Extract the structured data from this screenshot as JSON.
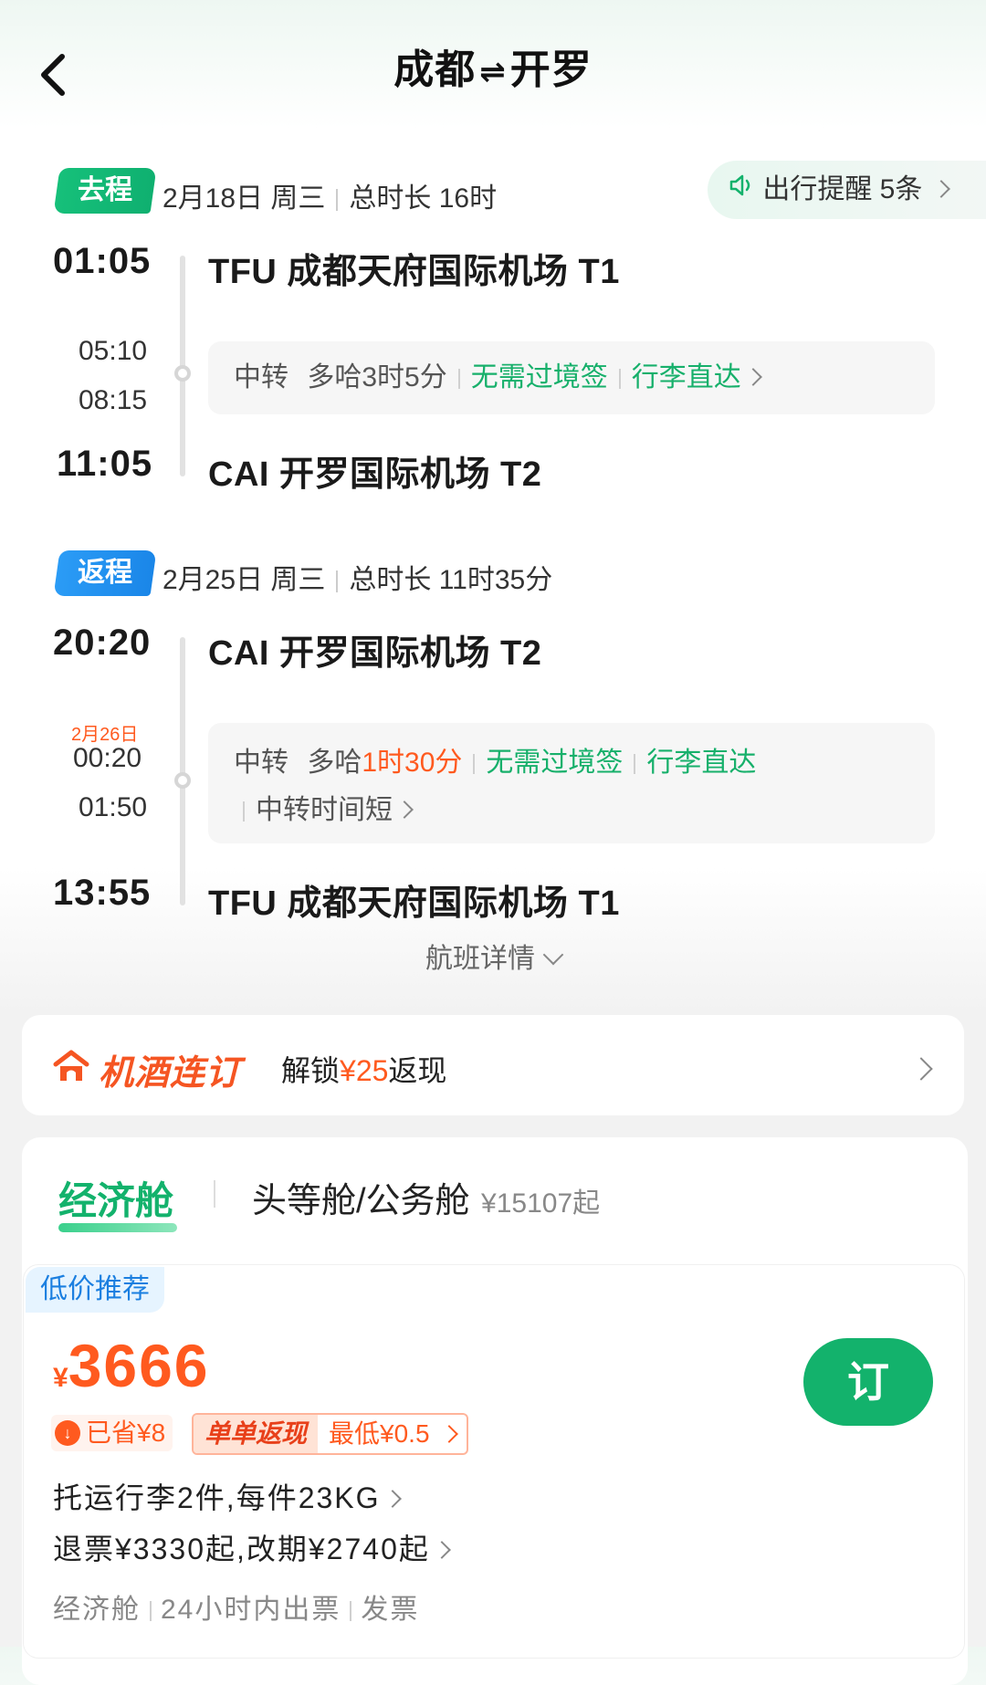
{
  "header": {
    "from": "成都",
    "to": "开罗",
    "swap_icon": "⇌"
  },
  "outbound": {
    "tag": "去程",
    "date": "2月18日 周三",
    "duration": "总时长 16时",
    "reminder": "出行提醒 5条",
    "depart_time": "01:05",
    "depart_airport": "TFU 成都天府国际机场 T1",
    "transfer_arrive": "05:10",
    "transfer_depart": "08:15",
    "transfer_label": "中转",
    "transfer_city_time": "多哈3时5分",
    "no_visa": "无需过境签",
    "baggage": "行李直达",
    "arrive_time": "11:05",
    "arrive_airport": "CAI 开罗国际机场 T2"
  },
  "return": {
    "tag": "返程",
    "date": "2月25日 周三",
    "duration": "总时长 11时35分",
    "depart_time": "20:20",
    "depart_airport": "CAI 开罗国际机场 T2",
    "next_day": "2月26日",
    "transfer_arrive": "00:20",
    "transfer_depart": "01:50",
    "transfer_label": "中转",
    "transfer_city": "多哈",
    "transfer_time": "1时30分",
    "no_visa": "无需过境签",
    "baggage": "行李直达",
    "short_transfer": "中转时间短",
    "arrive_time": "13:55",
    "arrive_airport": "TFU 成都天府国际机场 T1"
  },
  "flight_detail": "航班详情",
  "bundle": {
    "title": "机酒连订",
    "unlock": "解锁",
    "amount": "¥25",
    "cashback": "返现"
  },
  "cabins": {
    "economy": "经济舱",
    "first": "头等舱/公务舱",
    "first_price": "¥15107起"
  },
  "offer": {
    "tag": "低价推荐",
    "currency": "¥",
    "price": "3666",
    "book": "订",
    "saved": "已省¥8",
    "cashback_label": "单单返现",
    "cashback_value": "最低¥0.5",
    "baggage": "托运行李2件,每件23KG",
    "refund": "退票¥3330起,改期¥2740起",
    "cabin": "经济舱",
    "ticketing": "24小时内出票",
    "invoice": "发票"
  },
  "colors": {
    "green": "#13b26c",
    "orange": "#ff5a1f",
    "blue": "#1a86e8"
  }
}
